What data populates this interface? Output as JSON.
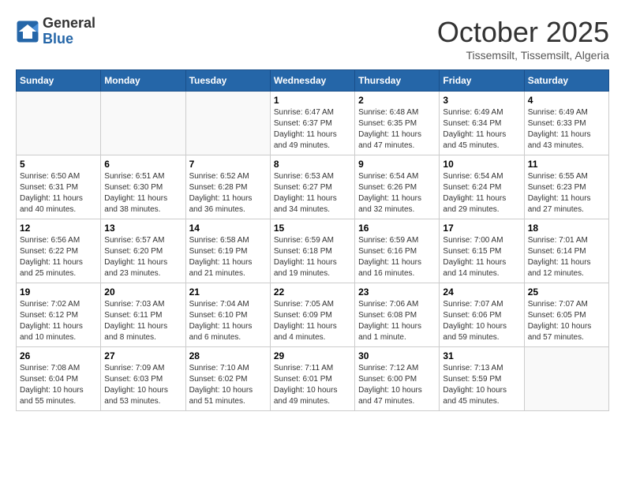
{
  "header": {
    "logo_line1": "General",
    "logo_line2": "Blue",
    "month": "October 2025",
    "location": "Tissemsilt, Tissemsilt, Algeria"
  },
  "days_of_week": [
    "Sunday",
    "Monday",
    "Tuesday",
    "Wednesday",
    "Thursday",
    "Friday",
    "Saturday"
  ],
  "weeks": [
    [
      {
        "day": "",
        "info": ""
      },
      {
        "day": "",
        "info": ""
      },
      {
        "day": "",
        "info": ""
      },
      {
        "day": "1",
        "info": "Sunrise: 6:47 AM\nSunset: 6:37 PM\nDaylight: 11 hours and 49 minutes."
      },
      {
        "day": "2",
        "info": "Sunrise: 6:48 AM\nSunset: 6:35 PM\nDaylight: 11 hours and 47 minutes."
      },
      {
        "day": "3",
        "info": "Sunrise: 6:49 AM\nSunset: 6:34 PM\nDaylight: 11 hours and 45 minutes."
      },
      {
        "day": "4",
        "info": "Sunrise: 6:49 AM\nSunset: 6:33 PM\nDaylight: 11 hours and 43 minutes."
      }
    ],
    [
      {
        "day": "5",
        "info": "Sunrise: 6:50 AM\nSunset: 6:31 PM\nDaylight: 11 hours and 40 minutes."
      },
      {
        "day": "6",
        "info": "Sunrise: 6:51 AM\nSunset: 6:30 PM\nDaylight: 11 hours and 38 minutes."
      },
      {
        "day": "7",
        "info": "Sunrise: 6:52 AM\nSunset: 6:28 PM\nDaylight: 11 hours and 36 minutes."
      },
      {
        "day": "8",
        "info": "Sunrise: 6:53 AM\nSunset: 6:27 PM\nDaylight: 11 hours and 34 minutes."
      },
      {
        "day": "9",
        "info": "Sunrise: 6:54 AM\nSunset: 6:26 PM\nDaylight: 11 hours and 32 minutes."
      },
      {
        "day": "10",
        "info": "Sunrise: 6:54 AM\nSunset: 6:24 PM\nDaylight: 11 hours and 29 minutes."
      },
      {
        "day": "11",
        "info": "Sunrise: 6:55 AM\nSunset: 6:23 PM\nDaylight: 11 hours and 27 minutes."
      }
    ],
    [
      {
        "day": "12",
        "info": "Sunrise: 6:56 AM\nSunset: 6:22 PM\nDaylight: 11 hours and 25 minutes."
      },
      {
        "day": "13",
        "info": "Sunrise: 6:57 AM\nSunset: 6:20 PM\nDaylight: 11 hours and 23 minutes."
      },
      {
        "day": "14",
        "info": "Sunrise: 6:58 AM\nSunset: 6:19 PM\nDaylight: 11 hours and 21 minutes."
      },
      {
        "day": "15",
        "info": "Sunrise: 6:59 AM\nSunset: 6:18 PM\nDaylight: 11 hours and 19 minutes."
      },
      {
        "day": "16",
        "info": "Sunrise: 6:59 AM\nSunset: 6:16 PM\nDaylight: 11 hours and 16 minutes."
      },
      {
        "day": "17",
        "info": "Sunrise: 7:00 AM\nSunset: 6:15 PM\nDaylight: 11 hours and 14 minutes."
      },
      {
        "day": "18",
        "info": "Sunrise: 7:01 AM\nSunset: 6:14 PM\nDaylight: 11 hours and 12 minutes."
      }
    ],
    [
      {
        "day": "19",
        "info": "Sunrise: 7:02 AM\nSunset: 6:12 PM\nDaylight: 11 hours and 10 minutes."
      },
      {
        "day": "20",
        "info": "Sunrise: 7:03 AM\nSunset: 6:11 PM\nDaylight: 11 hours and 8 minutes."
      },
      {
        "day": "21",
        "info": "Sunrise: 7:04 AM\nSunset: 6:10 PM\nDaylight: 11 hours and 6 minutes."
      },
      {
        "day": "22",
        "info": "Sunrise: 7:05 AM\nSunset: 6:09 PM\nDaylight: 11 hours and 4 minutes."
      },
      {
        "day": "23",
        "info": "Sunrise: 7:06 AM\nSunset: 6:08 PM\nDaylight: 11 hours and 1 minute."
      },
      {
        "day": "24",
        "info": "Sunrise: 7:07 AM\nSunset: 6:06 PM\nDaylight: 10 hours and 59 minutes."
      },
      {
        "day": "25",
        "info": "Sunrise: 7:07 AM\nSunset: 6:05 PM\nDaylight: 10 hours and 57 minutes."
      }
    ],
    [
      {
        "day": "26",
        "info": "Sunrise: 7:08 AM\nSunset: 6:04 PM\nDaylight: 10 hours and 55 minutes."
      },
      {
        "day": "27",
        "info": "Sunrise: 7:09 AM\nSunset: 6:03 PM\nDaylight: 10 hours and 53 minutes."
      },
      {
        "day": "28",
        "info": "Sunrise: 7:10 AM\nSunset: 6:02 PM\nDaylight: 10 hours and 51 minutes."
      },
      {
        "day": "29",
        "info": "Sunrise: 7:11 AM\nSunset: 6:01 PM\nDaylight: 10 hours and 49 minutes."
      },
      {
        "day": "30",
        "info": "Sunrise: 7:12 AM\nSunset: 6:00 PM\nDaylight: 10 hours and 47 minutes."
      },
      {
        "day": "31",
        "info": "Sunrise: 7:13 AM\nSunset: 5:59 PM\nDaylight: 10 hours and 45 minutes."
      },
      {
        "day": "",
        "info": ""
      }
    ]
  ]
}
